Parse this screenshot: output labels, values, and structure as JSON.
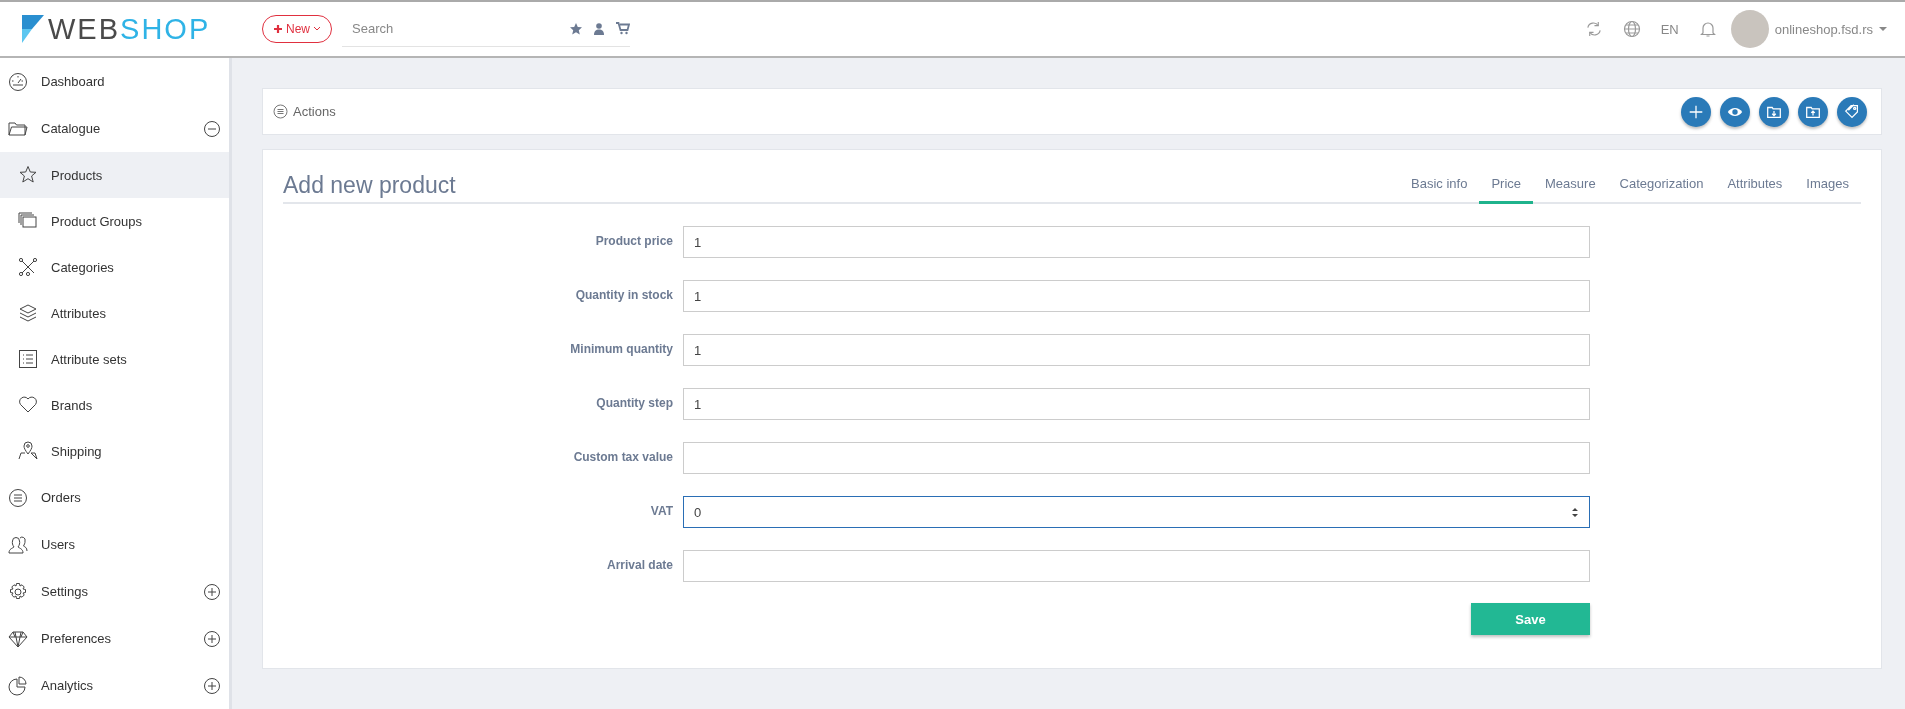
{
  "header": {
    "logo": [
      "WEB",
      "SHOP"
    ],
    "new_button": "New",
    "search": {
      "placeholder": "Search"
    },
    "language": "EN",
    "user": "onlineshop.fsd.rs"
  },
  "sidebar": {
    "items": [
      {
        "label": "Dashboard",
        "selected": false
      },
      {
        "label": "Catalogue",
        "selected": false,
        "expanded": true,
        "children": [
          {
            "label": "Products",
            "selected": true
          },
          {
            "label": "Product Groups",
            "selected": false
          },
          {
            "label": "Categories",
            "selected": false
          },
          {
            "label": "Attributes",
            "selected": false
          },
          {
            "label": "Attribute sets",
            "selected": false
          },
          {
            "label": "Brands",
            "selected": false
          },
          {
            "label": "Shipping",
            "selected": false
          }
        ]
      },
      {
        "label": "Orders",
        "selected": false
      },
      {
        "label": "Users",
        "selected": false
      },
      {
        "label": "Settings",
        "selected": false,
        "expanded": false
      },
      {
        "label": "Preferences",
        "selected": false,
        "expanded": false
      },
      {
        "label": "Analytics",
        "selected": false,
        "expanded": false
      }
    ]
  },
  "actions": {
    "label": "Actions"
  },
  "form": {
    "title": "Add new product",
    "tabs": [
      {
        "label": "Basic info",
        "selected": false
      },
      {
        "label": "Price",
        "selected": true
      },
      {
        "label": "Measure",
        "selected": false
      },
      {
        "label": "Categorization",
        "selected": false
      },
      {
        "label": "Attributes",
        "selected": false
      },
      {
        "label": "Images",
        "selected": false
      }
    ],
    "fields": [
      {
        "label": "Product price",
        "value": "1",
        "kind": "text",
        "focused": false
      },
      {
        "label": "Quantity in stock",
        "value": "1",
        "kind": "text",
        "focused": false
      },
      {
        "label": "Minimum quantity",
        "value": "1",
        "kind": "text",
        "focused": false
      },
      {
        "label": "Quantity step",
        "value": "1",
        "kind": "text",
        "focused": false
      },
      {
        "label": "Custom tax value",
        "kind": "text",
        "focused": false
      },
      {
        "label": "VAT",
        "value": "0",
        "kind": "number",
        "focused": true
      },
      {
        "label": "Arrival date",
        "kind": "text",
        "focused": false
      }
    ],
    "save_button": "Save"
  }
}
